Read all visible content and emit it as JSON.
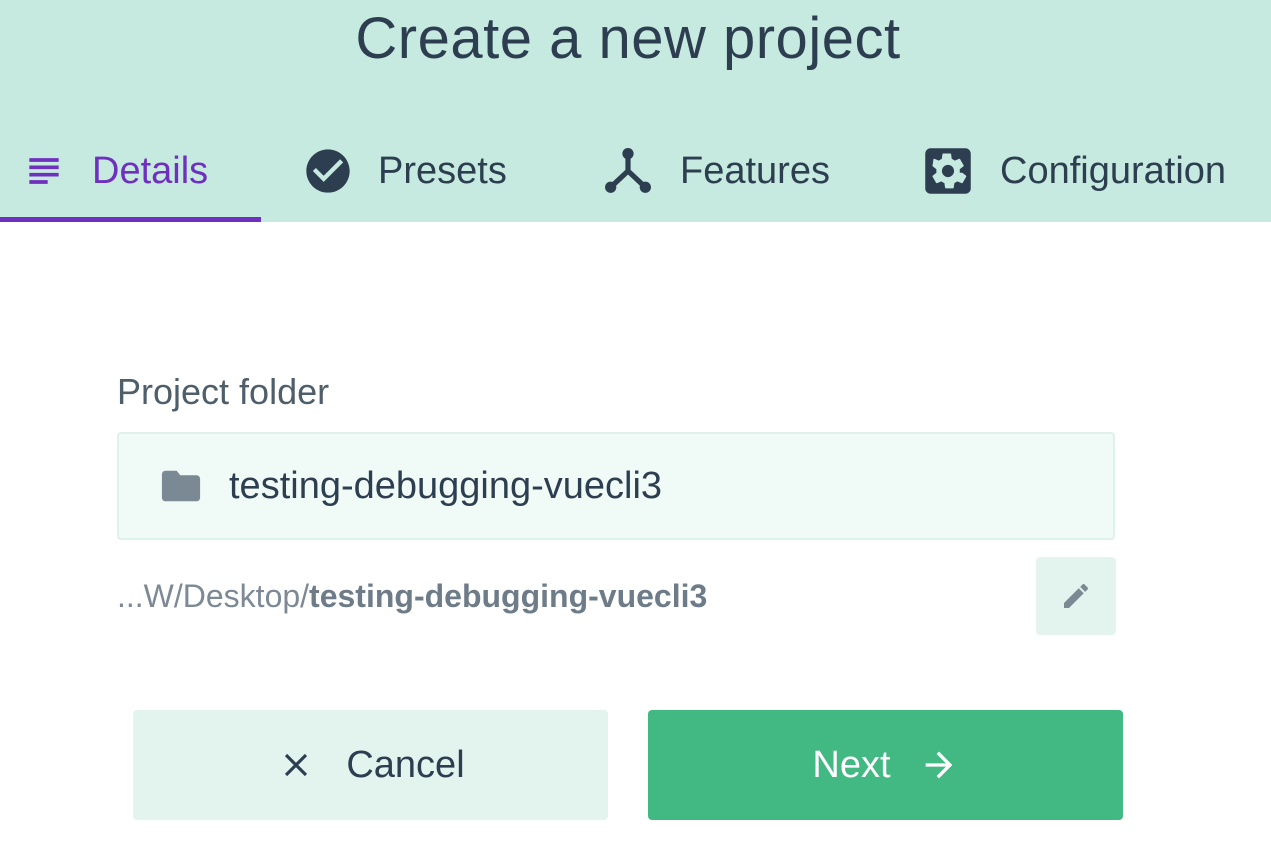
{
  "header": {
    "title": "Create a new project",
    "background_color": "#c7eae0"
  },
  "tabs": [
    {
      "label": "Details",
      "icon": "subject-icon",
      "active": true
    },
    {
      "label": "Presets",
      "icon": "check-circle-icon",
      "active": false
    },
    {
      "label": "Features",
      "icon": "call-split-icon",
      "active": false
    },
    {
      "label": "Configuration",
      "icon": "settings-icon",
      "active": false
    }
  ],
  "form": {
    "folder_label": "Project folder",
    "folder_value": "testing-debugging-vuecli3",
    "folder_icon": "folder-icon",
    "path_prefix": "...W/Desktop/",
    "path_name": "testing-debugging-vuecli3",
    "edit_icon": "pencil-icon"
  },
  "actions": {
    "cancel_label": "Cancel",
    "cancel_icon": "close-icon",
    "next_label": "Next",
    "next_icon": "arrow-right-icon"
  },
  "colors": {
    "accent": "#6f2fbf",
    "primary": "#42b983",
    "text": "#2c3e50"
  }
}
